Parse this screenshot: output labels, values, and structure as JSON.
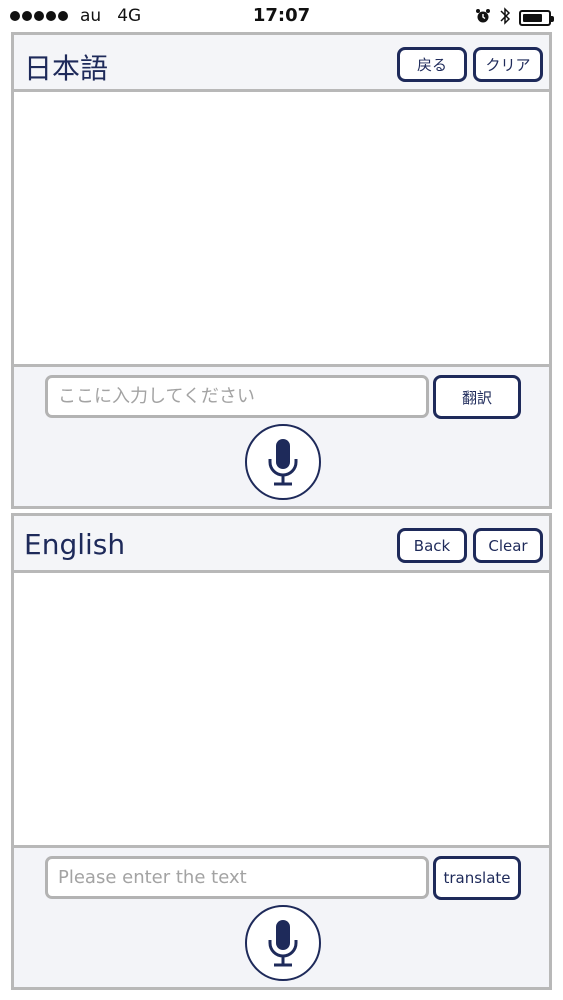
{
  "status_bar": {
    "carrier": "au",
    "network": "4G",
    "time": "17:07",
    "signal_bars": 5,
    "battery_level": 0.8
  },
  "japanese_panel": {
    "title": "日本語",
    "back_label": "戻る",
    "clear_label": "クリア",
    "input_placeholder": "ここに入力してください",
    "input_value": "",
    "translate_label": "翻訳",
    "text_content": ""
  },
  "english_panel": {
    "title": "English",
    "back_label": "Back",
    "clear_label": "Clear",
    "input_placeholder": "Please enter the text",
    "input_value": "",
    "translate_label": "translate",
    "text_content": ""
  },
  "colors": {
    "accent": "#1e2a5a",
    "border": "#b8b8b8",
    "panel_background": "#f3f4f8"
  },
  "icons": {
    "mic": "microphone-icon",
    "alarm": "alarm-clock-icon",
    "bluetooth": "bluetooth-icon",
    "battery": "battery-icon"
  }
}
